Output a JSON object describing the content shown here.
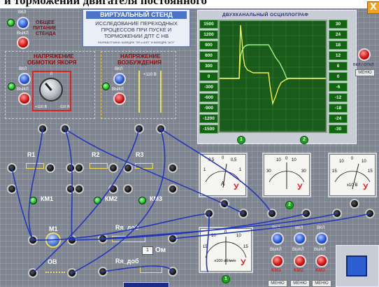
{
  "top_caption": "и торможении двигателя постоянного",
  "close_label": "X",
  "header": {
    "title": "ВИРТУАЛЬНЫЙ СТЕНД",
    "line1": "ИССЛЕДОВАНИЕ ПЕРЕХОДНЫХ",
    "line2": "ПРОЦЕССОВ ПРИ ПУСКЕ И",
    "line3": "ТОРМОЖЕНИИ ДПТ С НВ",
    "credits": "РАЗРАБОТЧИКИ: КАФЕДРА \"ЭП и АЭП\" И КАФЕДРА \"АСУ\""
  },
  "power": {
    "label_line1": "ОБЩЕЕ",
    "label_line2": "ПИТАНИЕ",
    "label_line3": "СТЕНДА",
    "on": "ВКЛ",
    "off": "ВЫКЛ"
  },
  "armature": {
    "title_line1": "НАПРЯЖЕНИЕ",
    "title_line2": "ОБМОТКИ ЯКОРЯ",
    "on": "ВКЛ",
    "off": "ВЫКЛ",
    "knob_top": "0",
    "knob_left": "+110 В",
    "knob_right": "-110 В"
  },
  "field": {
    "title_line1": "НАПРЯЖЕНИЕ",
    "title_line2": "ВОЗБУЖДЕНИЯ",
    "on": "ВКЛ",
    "off": "ВЫКЛ",
    "voltage": "+110 В"
  },
  "oscilloscope": {
    "title": "ДВУХКАНАЛЬНЫЙ ОСЦИЛЛОГРАФ",
    "left_scale": [
      "1500",
      "1200",
      "900",
      "600",
      "300",
      "0",
      "-300",
      "-600",
      "-900",
      "-1200",
      "-1500"
    ],
    "right_scale": [
      "30",
      "24",
      "18",
      "12",
      "6",
      "0",
      "-6",
      "-12",
      "-18",
      "-24",
      "-30"
    ],
    "ch1": "1",
    "ch2": "2",
    "onoff": "ВКЛ / ОТКЛ",
    "menu": "МЕНЮ"
  },
  "meters": {
    "ammeter": {
      "unit": "А",
      "label": "У",
      "ticks": [
        "1",
        "0,5",
        "0",
        "0,5",
        "1"
      ]
    },
    "voltmeter1": {
      "label": "У",
      "ticks": [
        "30",
        "20",
        "10",
        "0",
        "10",
        "20",
        "30"
      ]
    },
    "voltmeter2": {
      "unit": "x10 В",
      "label": "У",
      "ticks": [
        "15",
        "10",
        "5",
        "0",
        "5",
        "10",
        "15"
      ]
    },
    "tachometer": {
      "unit": "x100 об/мин",
      "label": "У",
      "ticks": [
        "15",
        "10",
        "5",
        "0",
        "5",
        "10",
        "15"
      ]
    }
  },
  "components": {
    "r1": "R1",
    "r2": "R2",
    "r3": "R3",
    "km1": "КМ1",
    "km2": "КМ2",
    "km3": "КМ3",
    "m1": "M1",
    "ob": "ОВ",
    "rya1": "Rя_доб",
    "rya2": "Rя_доб",
    "ohm": "Ом",
    "ohm_value": "1"
  },
  "contactors": {
    "on": "ВКЛ",
    "off": "ВЫКЛ",
    "km1": "КМ1",
    "km2": "КМ2",
    "km3": "КМ3",
    "menu": "МЕНЮ"
  },
  "node_labels": {
    "node1": "2",
    "node2": "1"
  },
  "colors": {
    "trace_yellow": "#f2f04a",
    "trace_green": "#9cf28a",
    "wire_blue": "#2236b8"
  }
}
